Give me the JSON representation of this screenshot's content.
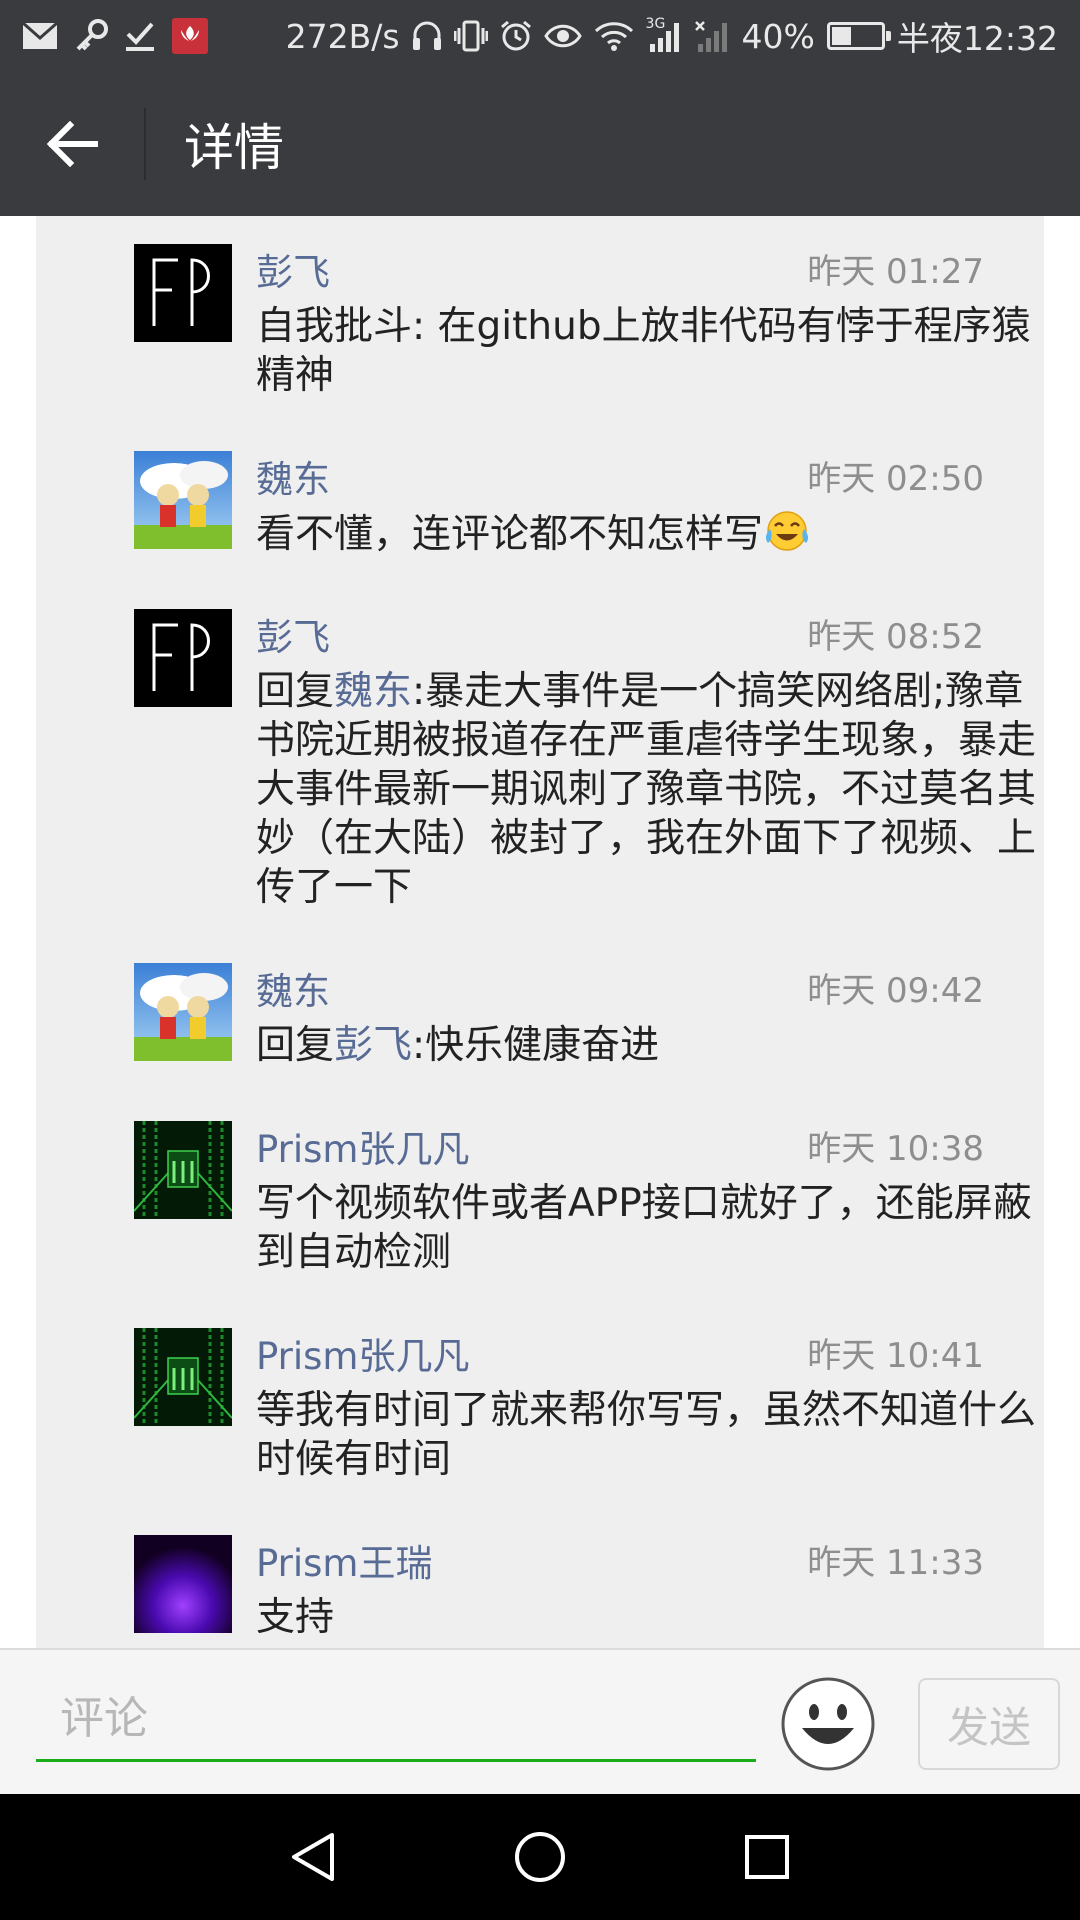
{
  "status_bar": {
    "net_speed": "272B/s",
    "network_type": "3G",
    "battery_text": "40%",
    "battery_level": 0.4,
    "time": "半夜12:32",
    "icons": [
      "mail-icon",
      "key-icon",
      "download-done-icon",
      "huawei-app-icon",
      "headset-icon",
      "vibrate-icon",
      "alarm-icon",
      "eye-icon",
      "wifi-icon",
      "signal-icon",
      "no-signal-icon",
      "battery-icon"
    ]
  },
  "title_bar": {
    "back_icon": "arrow-left-icon",
    "title": "详情"
  },
  "comments": [
    {
      "avatar": "fp-letters",
      "name": "彭飞",
      "time": "昨天 01:27",
      "text": "自我批斗: 在github上放非代码有悖于程序猿精神"
    },
    {
      "avatar": "kids-field-photo",
      "name": "魏东",
      "time": "昨天 02:50",
      "text": "看不懂，连评论都不知怎样写",
      "emoji": "tears-of-joy-emoji"
    },
    {
      "avatar": "fp-letters",
      "name": "彭飞",
      "time": "昨天 08:52",
      "reply_prefix": "回复",
      "reply_to": "魏东",
      "text": ":暴走大事件是一个搞笑网络剧;豫章书院近期被报道存在严重虐待学生现象，暴走大事件最新一期讽刺了豫章书院，不过莫名其妙（在大陆）被封了，我在外面下了视频、上传了一下"
    },
    {
      "avatar": "kids-field-photo",
      "name": "魏东",
      "time": "昨天 09:42",
      "reply_prefix": "回复",
      "reply_to": "彭飞",
      "text": ":快乐健康奋进"
    },
    {
      "avatar": "green-matrix",
      "name": "Prism张几凡",
      "time": "昨天 10:38",
      "text": "写个视频软件或者APP接口就好了，还能屏蔽到自动检测"
    },
    {
      "avatar": "green-matrix",
      "name": "Prism张几凡",
      "time": "昨天 10:41",
      "text": "等我有时间了就来帮你写写，虽然不知道什么时候有时间"
    },
    {
      "avatar": "purple-glow",
      "name": "Prism王瑞",
      "time": "昨天 11:33",
      "text": "支持"
    }
  ],
  "input_bar": {
    "placeholder": "评论",
    "value": "",
    "emoji_icon": "smiley-face-icon",
    "send_label": "发送"
  },
  "nav_bar": {
    "icons": [
      "back-triangle-icon",
      "home-circle-icon",
      "recents-square-icon"
    ]
  },
  "colors": {
    "bar_bg": "#3a3b3f",
    "panel_bg": "#efeff0",
    "name_link": "#576b95",
    "accent_green": "#1aad19"
  }
}
